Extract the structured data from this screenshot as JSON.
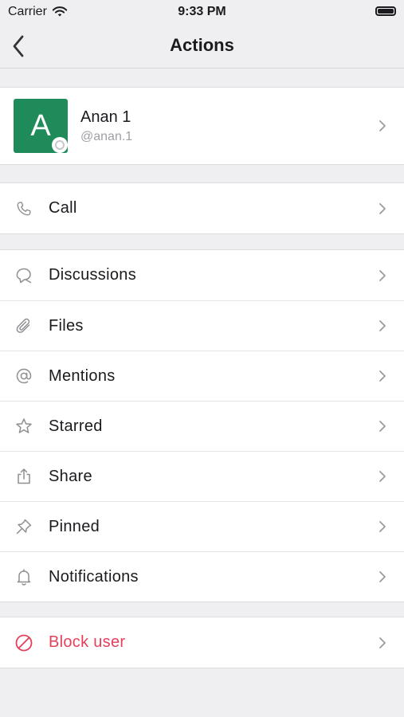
{
  "status_bar": {
    "carrier": "Carrier",
    "time": "9:33 PM"
  },
  "nav": {
    "title": "Actions"
  },
  "profile": {
    "avatar_letter": "A",
    "name": "Anan 1",
    "handle": "@anan.1",
    "avatar_color": "#1f8a5a"
  },
  "call_group": [
    {
      "label": "Call",
      "icon": "phone-icon"
    }
  ],
  "menu_items": [
    {
      "label": "Discussions",
      "icon": "discussion-icon"
    },
    {
      "label": "Files",
      "icon": "paperclip-icon"
    },
    {
      "label": "Mentions",
      "icon": "at-icon"
    },
    {
      "label": "Starred",
      "icon": "star-icon"
    },
    {
      "label": "Share",
      "icon": "share-icon"
    },
    {
      "label": "Pinned",
      "icon": "pin-icon"
    },
    {
      "label": "Notifications",
      "icon": "bell-icon"
    }
  ],
  "block": {
    "label": "Block user",
    "icon": "block-icon",
    "color": "#e4405a"
  },
  "colors": {
    "background": "#efeff2",
    "accent_danger": "#e4405a",
    "icon_gray": "#8e8e93"
  }
}
